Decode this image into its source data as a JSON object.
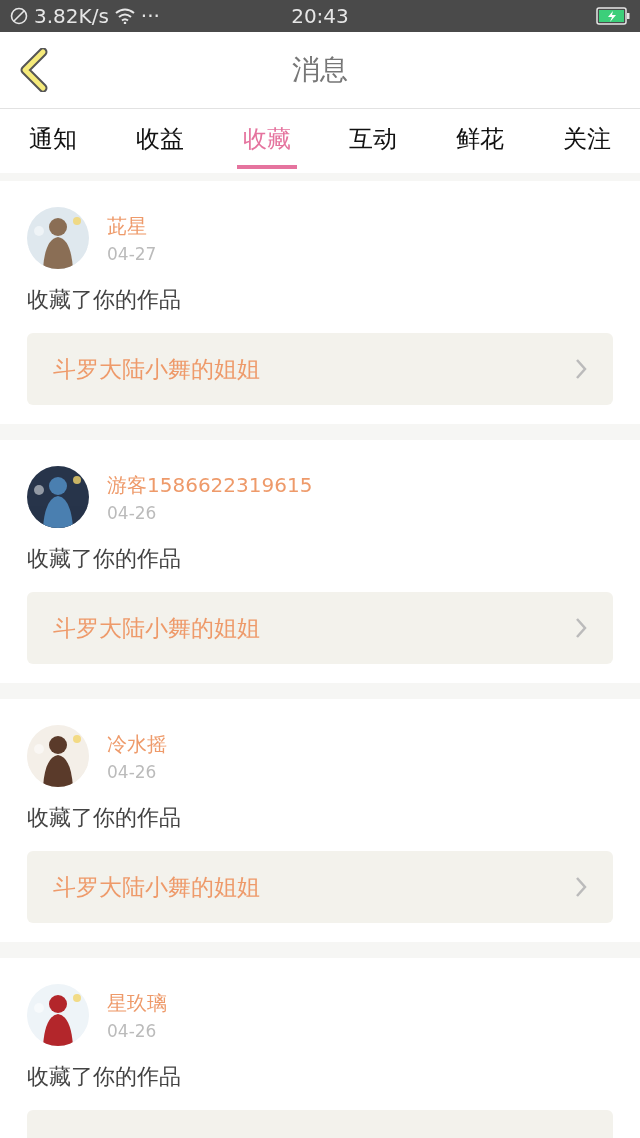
{
  "status_bar": {
    "speed": "3.82K/s",
    "more": "···",
    "time": "20:43",
    "battery_charging": true
  },
  "header": {
    "title": "消息"
  },
  "tabs": [
    {
      "label": "通知",
      "selected": false
    },
    {
      "label": "收益",
      "selected": false
    },
    {
      "label": "收藏",
      "selected": true
    },
    {
      "label": "互动",
      "selected": false
    },
    {
      "label": "鲜花",
      "selected": false
    },
    {
      "label": "关注",
      "selected": false
    }
  ],
  "messages": [
    {
      "user": "茈星",
      "date": "04-27",
      "text": "收藏了你的作品",
      "work": "斗罗大陆小舞的姐姐"
    },
    {
      "user": "游客1586622319615",
      "date": "04-26",
      "text": "收藏了你的作品",
      "work": "斗罗大陆小舞的姐姐"
    },
    {
      "user": "冷水摇",
      "date": "04-26",
      "text": "收藏了你的作品",
      "work": "斗罗大陆小舞的姐姐"
    },
    {
      "user": "星玖璃",
      "date": "04-26",
      "text": "收藏了你的作品"
    }
  ]
}
